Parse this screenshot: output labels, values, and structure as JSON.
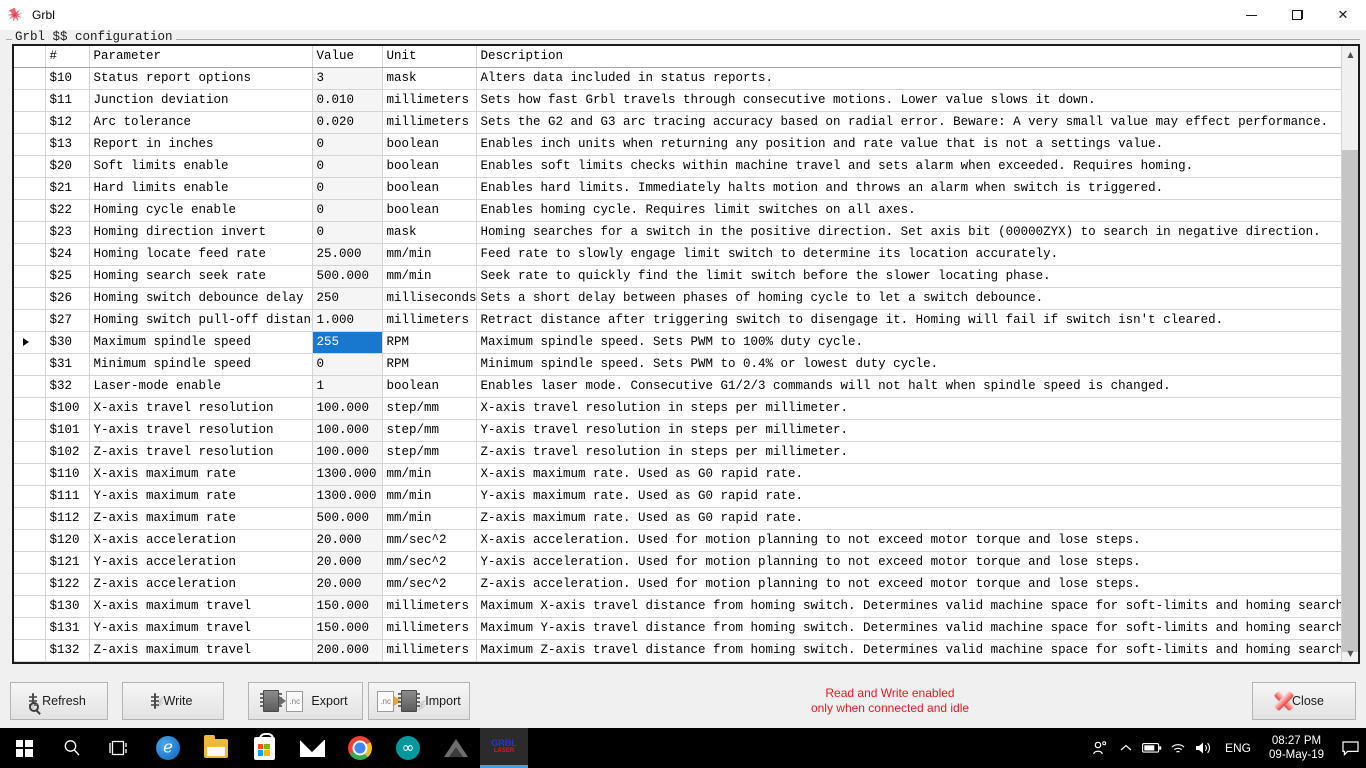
{
  "window": {
    "title": "Grbl",
    "icon": "grbl-starburst-icon",
    "minimize_label": "Minimize",
    "maximize_label": "Restore",
    "close_label": "Close"
  },
  "groupbox": {
    "label": "Grbl $$ configuration"
  },
  "grid": {
    "columns": [
      "",
      "#",
      "Parameter",
      "Value",
      "Unit",
      "Description"
    ],
    "selected_row_id": "$30",
    "selected_cell_value": "255",
    "selection_color": "#1878cf",
    "rows": [
      {
        "num": "$10",
        "parameter": "Status report options",
        "value": "3",
        "unit": "mask",
        "description": "Alters data included in status reports."
      },
      {
        "num": "$11",
        "parameter": "Junction deviation",
        "value": "0.010",
        "unit": "millimeters",
        "description": "Sets how fast Grbl travels through consecutive motions. Lower value slows it down."
      },
      {
        "num": "$12",
        "parameter": "Arc tolerance",
        "value": "0.020",
        "unit": "millimeters",
        "description": "Sets the G2 and G3 arc tracing accuracy based on radial error. Beware: A very small value may effect performance."
      },
      {
        "num": "$13",
        "parameter": "Report in inches",
        "value": "0",
        "unit": "boolean",
        "description": "Enables inch units when returning any position and rate value that is not a settings value."
      },
      {
        "num": "$20",
        "parameter": "Soft limits enable",
        "value": "0",
        "unit": "boolean",
        "description": "Enables soft limits checks within machine travel and sets alarm when exceeded. Requires homing."
      },
      {
        "num": "$21",
        "parameter": "Hard limits enable",
        "value": "0",
        "unit": "boolean",
        "description": "Enables hard limits. Immediately halts motion and throws an alarm when switch is triggered."
      },
      {
        "num": "$22",
        "parameter": "Homing cycle enable",
        "value": "0",
        "unit": "boolean",
        "description": "Enables homing cycle. Requires limit switches on all axes."
      },
      {
        "num": "$23",
        "parameter": "Homing direction invert",
        "value": "0",
        "unit": "mask",
        "description": "Homing searches for a switch in the positive direction. Set axis bit (00000ZYX) to search in negative direction."
      },
      {
        "num": "$24",
        "parameter": "Homing locate feed rate",
        "value": "25.000",
        "unit": "mm/min",
        "description": "Feed rate to slowly engage limit switch to determine its location accurately."
      },
      {
        "num": "$25",
        "parameter": "Homing search seek rate",
        "value": "500.000",
        "unit": "mm/min",
        "description": "Seek rate to quickly find the limit switch before the slower locating phase."
      },
      {
        "num": "$26",
        "parameter": "Homing switch debounce delay",
        "value": "250",
        "unit": "milliseconds",
        "description": "Sets a short delay between phases of homing cycle to let a switch debounce."
      },
      {
        "num": "$27",
        "parameter": "Homing switch pull-off distance",
        "value": "1.000",
        "unit": "millimeters",
        "description": "Retract distance after triggering switch to disengage it. Homing will fail if switch isn't cleared."
      },
      {
        "num": "$30",
        "parameter": "Maximum spindle speed",
        "value": "255",
        "unit": "RPM",
        "description": "Maximum spindle speed. Sets PWM to 100% duty cycle."
      },
      {
        "num": "$31",
        "parameter": "Minimum spindle speed",
        "value": "0",
        "unit": "RPM",
        "description": "Minimum spindle speed. Sets PWM to 0.4% or lowest duty cycle."
      },
      {
        "num": "$32",
        "parameter": "Laser-mode enable",
        "value": "1",
        "unit": "boolean",
        "description": "Enables laser mode. Consecutive G1/2/3 commands will not halt when spindle speed is changed."
      },
      {
        "num": "$100",
        "parameter": "X-axis travel resolution",
        "value": "100.000",
        "unit": "step/mm",
        "description": "X-axis travel resolution in steps per millimeter."
      },
      {
        "num": "$101",
        "parameter": "Y-axis travel resolution",
        "value": "100.000",
        "unit": "step/mm",
        "description": "Y-axis travel resolution in steps per millimeter."
      },
      {
        "num": "$102",
        "parameter": "Z-axis travel resolution",
        "value": "100.000",
        "unit": "step/mm",
        "description": "Z-axis travel resolution in steps per millimeter."
      },
      {
        "num": "$110",
        "parameter": "X-axis maximum rate",
        "value": "1300.000",
        "unit": "mm/min",
        "description": "X-axis maximum rate. Used as G0 rapid rate."
      },
      {
        "num": "$111",
        "parameter": "Y-axis maximum rate",
        "value": "1300.000",
        "unit": "mm/min",
        "description": "Y-axis maximum rate. Used as G0 rapid rate."
      },
      {
        "num": "$112",
        "parameter": "Z-axis maximum rate",
        "value": "500.000",
        "unit": "mm/min",
        "description": "Z-axis maximum rate. Used as G0 rapid rate."
      },
      {
        "num": "$120",
        "parameter": "X-axis acceleration",
        "value": "20.000",
        "unit": "mm/sec^2",
        "description": "X-axis acceleration. Used for motion planning to not exceed motor torque and lose steps."
      },
      {
        "num": "$121",
        "parameter": "Y-axis acceleration",
        "value": "20.000",
        "unit": "mm/sec^2",
        "description": "Y-axis acceleration. Used for motion planning to not exceed motor torque and lose steps."
      },
      {
        "num": "$122",
        "parameter": "Z-axis acceleration",
        "value": "20.000",
        "unit": "mm/sec^2",
        "description": "Z-axis acceleration. Used for motion planning to not exceed motor torque and lose steps."
      },
      {
        "num": "$130",
        "parameter": "X-axis maximum travel",
        "value": "150.000",
        "unit": "millimeters",
        "description": "Maximum X-axis travel distance from homing switch. Determines valid machine space for soft-limits and homing search dist..."
      },
      {
        "num": "$131",
        "parameter": "Y-axis maximum travel",
        "value": "150.000",
        "unit": "millimeters",
        "description": "Maximum Y-axis travel distance from homing switch. Determines valid machine space for soft-limits and homing search dist..."
      },
      {
        "num": "$132",
        "parameter": "Z-axis maximum travel",
        "value": "200.000",
        "unit": "millimeters",
        "description": "Maximum Z-axis travel distance from homing switch. Determines valid machine space for soft-limits and homing search dist..."
      }
    ]
  },
  "toolbar": {
    "refresh_label": "Refresh",
    "write_label": "Write",
    "export_label": "Export",
    "import_label": "Import",
    "close_label": "Close",
    "export_doc_text": ".nc",
    "import_doc_text": ".nc",
    "status_line1": "Read and Write enabled",
    "status_line2": "only when connected and idle",
    "status_color": "#e01b24"
  },
  "taskbar": {
    "items": [
      {
        "name": "start",
        "label": "Start"
      },
      {
        "name": "search",
        "label": "Search"
      },
      {
        "name": "task-view",
        "label": "Task View"
      },
      {
        "name": "edge",
        "label": "Microsoft Edge"
      },
      {
        "name": "file-explorer",
        "label": "File Explorer"
      },
      {
        "name": "microsoft-store",
        "label": "Microsoft Store"
      },
      {
        "name": "mail",
        "label": "Mail"
      },
      {
        "name": "chrome",
        "label": "Google Chrome"
      },
      {
        "name": "arduino",
        "label": "Arduino IDE"
      },
      {
        "name": "inkscape",
        "label": "Inkscape"
      },
      {
        "name": "grbl-app",
        "label": "Grbl"
      }
    ],
    "grbl_icon_top": "GRBL",
    "grbl_icon_bottom": "LASER",
    "tray": {
      "people_label": "People",
      "show_hidden_label": "Show hidden icons",
      "battery_label": "Battery",
      "network_label": "Network",
      "volume_label": "Volume",
      "language": "ENG",
      "time": "08:27 PM",
      "date": "09-May-19",
      "action_center_label": "Action Center"
    }
  }
}
